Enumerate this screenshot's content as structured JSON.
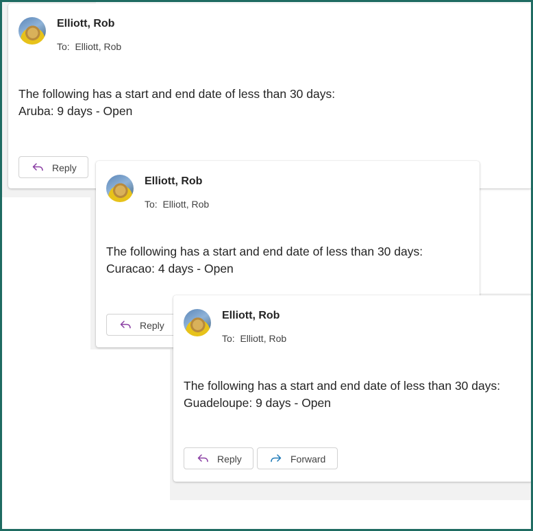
{
  "messages": [
    {
      "sender": "Elliott, Rob",
      "to": "To:  Elliott, Rob",
      "body": [
        "The following has a start and end date of less than 30 days:",
        "Aruba: 9 days - Open"
      ],
      "actions": [
        {
          "label": "Reply",
          "icon": "reply-icon"
        }
      ]
    },
    {
      "sender": "Elliott, Rob",
      "to": "To:  Elliott, Rob",
      "body": [
        "The following has a start and end date of less than 30 days:",
        "Curacao: 4 days - Open"
      ],
      "actions": [
        {
          "label": "Reply",
          "icon": "reply-icon"
        }
      ]
    },
    {
      "sender": "Elliott, Rob",
      "to": "To:  Elliott, Rob",
      "body": [
        "The following has a start and end date of less than 30 days:",
        "Guadeloupe: 9 days - Open"
      ],
      "actions": [
        {
          "label": "Reply",
          "icon": "reply-icon"
        },
        {
          "label": "Forward",
          "icon": "forward-icon"
        }
      ]
    }
  ],
  "colors": {
    "frame": "#1f6b62",
    "reply_icon": "#8a3ea3",
    "forward_icon": "#1f7ab8"
  }
}
